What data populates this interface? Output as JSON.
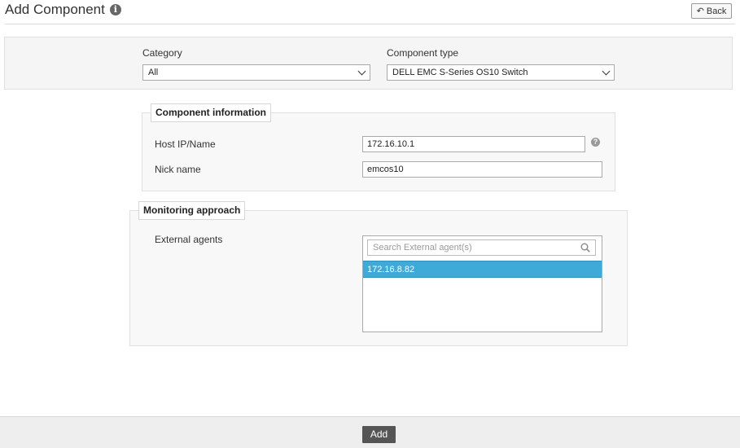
{
  "header": {
    "title": "Add Component",
    "info_icon": "info-icon",
    "back_label": "Back",
    "back_icon": "reply-arrow-icon"
  },
  "filters": {
    "category_label": "Category",
    "category_value": "All",
    "component_type_label": "Component type",
    "component_type_value": "DELL EMC S-Series OS10 Switch"
  },
  "component_information": {
    "legend": "Component information",
    "host_label": "Host IP/Name",
    "host_value": "172.16.10.1",
    "help_icon": "question-icon",
    "nick_label": "Nick name",
    "nick_value": "emcos10"
  },
  "monitoring_approach": {
    "legend": "Monitoring approach",
    "external_agents_label": "External agents",
    "search_placeholder": "Search External agent(s)",
    "agents": [
      "172.16.8.82"
    ]
  },
  "footer": {
    "add_label": "Add"
  },
  "colors": {
    "selected_row": "#3fa9d8",
    "add_button": "#555555"
  }
}
